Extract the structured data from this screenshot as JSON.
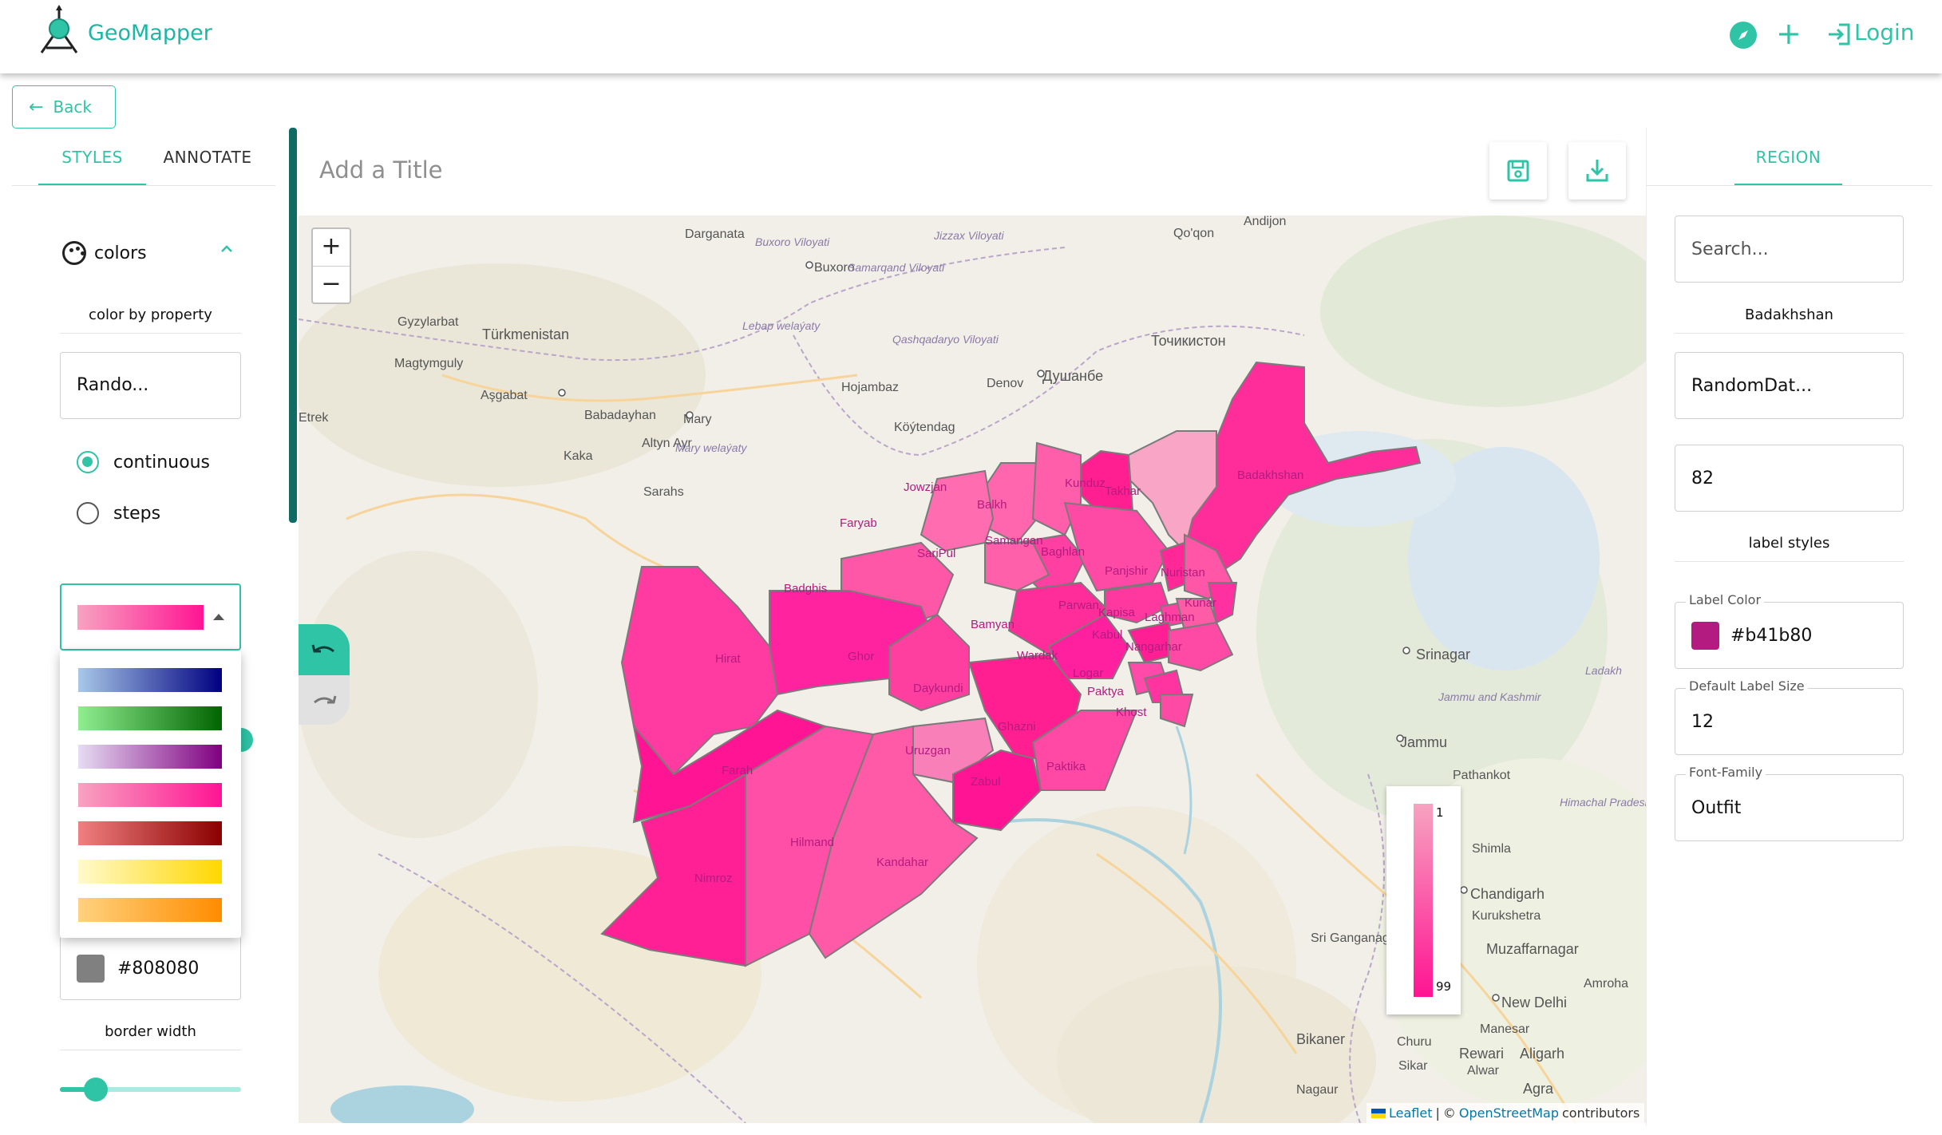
{
  "app": {
    "name": "GeoMapper",
    "login_label": "Login",
    "accent": "#2ec4a5"
  },
  "back": {
    "label": "Back"
  },
  "left_panel": {
    "tabs": [
      {
        "label": "STYLES",
        "active": true
      },
      {
        "label": "ANNOTATE",
        "active": false
      }
    ],
    "colors_section": {
      "title": "colors",
      "expanded": true
    },
    "color_by_label": "color by property",
    "color_by_value": "Rando...",
    "mode_options": [
      {
        "label": "continuous",
        "selected": true
      },
      {
        "label": "steps",
        "selected": false
      }
    ],
    "selected_palette": [
      "#f7a3c0",
      "#ff1493"
    ],
    "palettes": [
      {
        "from": "#a8c8e8",
        "to": "#000080"
      },
      {
        "from": "#90ee90",
        "to": "#006400"
      },
      {
        "from": "#e6dcf2",
        "to": "#800080"
      },
      {
        "from": "#f7a3c0",
        "to": "#ff1493"
      },
      {
        "from": "#f08080",
        "to": "#8b0000"
      },
      {
        "from": "#fffacd",
        "to": "#ffd700"
      },
      {
        "from": "#ffd27f",
        "to": "#ff8c00"
      }
    ],
    "border_color_value": "#808080",
    "border_width_label": "border width",
    "border_width_level": 0.2
  },
  "main": {
    "title_placeholder": "Add a Title",
    "zoom_in": "+",
    "zoom_out": "−",
    "legend": {
      "min": "1",
      "max": "99",
      "from": "#f7a3c0",
      "to": "#ff1493"
    },
    "attribution": {
      "leaflet": "Leaflet",
      "sep": "|",
      "copy": "©",
      "osm": "OpenStreetMap",
      "suffix": "contributors"
    },
    "map_labels": {
      "places": [
        "Darganata",
        "Buxoro",
        "Andijon",
        "Qo'qon",
        "Türkmenistan",
        "Gyzylarbat",
        "Magtymguly",
        "Aşgabat",
        "Babadayhan",
        "Mary",
        "Altyn Ayr",
        "Kaka",
        "Sarahs",
        "Etrek",
        "Hojambaz",
        "Köýtendag",
        "Denov",
        "Душанбе",
        "Точикистон",
        "Srinagar",
        "Jammu",
        "Shimla",
        "Chandigarh",
        "Kurukshetra",
        "Muzaffarnagar",
        "New Delhi",
        "Bikaner",
        "Churu",
        "Rewari",
        "Sikar",
        "Nagaur",
        "Alwar",
        "Aligarh",
        "Agra",
        "Sri Ganganagar",
        "Amroha",
        "Pathankot",
        "Manesar",
        "Mary welaýaty",
        "Lebap welaýaty",
        "Buxoro Viloyati",
        "Jizzax Viloyati",
        "Samarqand Viloyati",
        "Qashqadaryo Viloyati",
        "Ladakh",
        "Jammu and Kashmir",
        "Himachal Pradesh"
      ],
      "provinces": [
        "Badakhshan",
        "Takhar",
        "Kunduz",
        "Jowzjan",
        "Balkh",
        "Samangan",
        "Faryab",
        "SariPul",
        "Baghlan",
        "Panjshir",
        "Nuristan",
        "Badghis",
        "Parwan",
        "Kapisa",
        "Laghman",
        "Kunar",
        "Bamyan",
        "Wardak",
        "Kabul",
        "Nangarhar",
        "Hirat",
        "Ghor",
        "Daykundi",
        "Logar",
        "Paktya",
        "Khost",
        "Ghazni",
        "Uruzgan",
        "Zabul",
        "Paktika",
        "Farah",
        "Hilmand",
        "Kandahar",
        "Nimroz"
      ]
    }
  },
  "right_panel": {
    "tabs": [
      {
        "label": "REGION",
        "active": true
      }
    ],
    "search_placeholder": "Search...",
    "region_name": "Badakhshan",
    "property_value": "RandomDat...",
    "value": "82",
    "label_styles_title": "label styles",
    "label_color_caption": "Label Color",
    "label_color_value": "#b41b80",
    "label_size_caption": "Default Label Size",
    "label_size_value": "12",
    "font_family_caption": "Font-Family",
    "font_family_value": "Outfit"
  }
}
